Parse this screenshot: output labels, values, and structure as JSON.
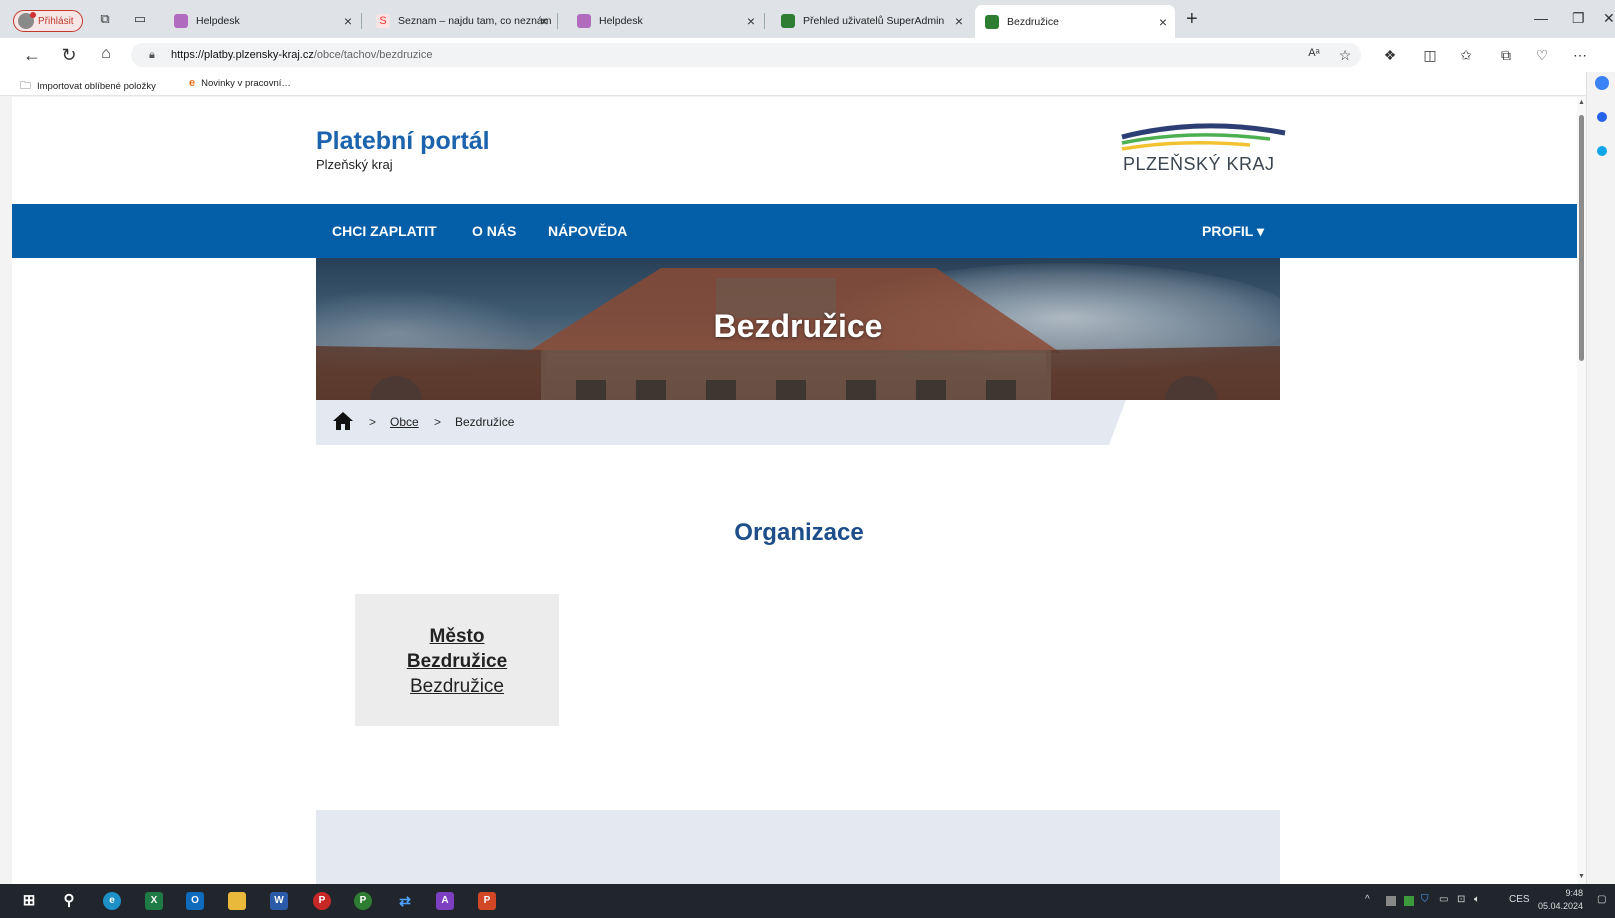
{
  "browser": {
    "profile_label": "Přihlásit",
    "tabs": [
      {
        "title": "Helpdesk",
        "favicon_color": "#b06bbf"
      },
      {
        "title": "Seznam – najdu tam, co neznám",
        "favicon_color": "#e33"
      },
      {
        "title": "Helpdesk",
        "favicon_color": "#b06bbf"
      },
      {
        "title": "Přehled uživatelů SuperAdmin",
        "favicon_color": "#2e7d32"
      },
      {
        "title": "Bezdružice",
        "favicon_color": "#2e7d32"
      }
    ],
    "close_glyph": "×",
    "new_tab_glyph": "+",
    "url_host": "https://platby.plzensky-kraj.cz",
    "url_path": "/obce/tachov/bezdruzice",
    "favorites": [
      {
        "label": "Importovat oblíbené položky",
        "icon": "folder-icon"
      },
      {
        "label": "Novinky v pracovní…",
        "icon": "edge-news-icon"
      }
    ]
  },
  "site": {
    "title": "Platební portál",
    "subtitle": "Plzeňský kraj",
    "logo_text": "PLZEŇSKÝ KRAJ",
    "nav": {
      "pay": "CHCI ZAPLATIT",
      "about": "O NÁS",
      "help": "NÁPOVĚDA",
      "profile": "PROFIL ▾"
    },
    "hero_title": "Bezdružice",
    "breadcrumb": {
      "separator": ">",
      "link": "Obce",
      "current": "Bezdružice"
    },
    "section_title": "Organizace",
    "organization": {
      "name_line1": "Město",
      "name_line2": "Bezdružice",
      "city": "Bezdružice"
    }
  },
  "taskbar": {
    "language": "CES",
    "time": "9:48",
    "date": "05.04.2024"
  },
  "colors": {
    "brand_blue": "#055ea8",
    "title_blue": "#1b63ad",
    "section_blue": "#1d4e8a",
    "breadcrumb_bg": "#e4e9f1"
  }
}
